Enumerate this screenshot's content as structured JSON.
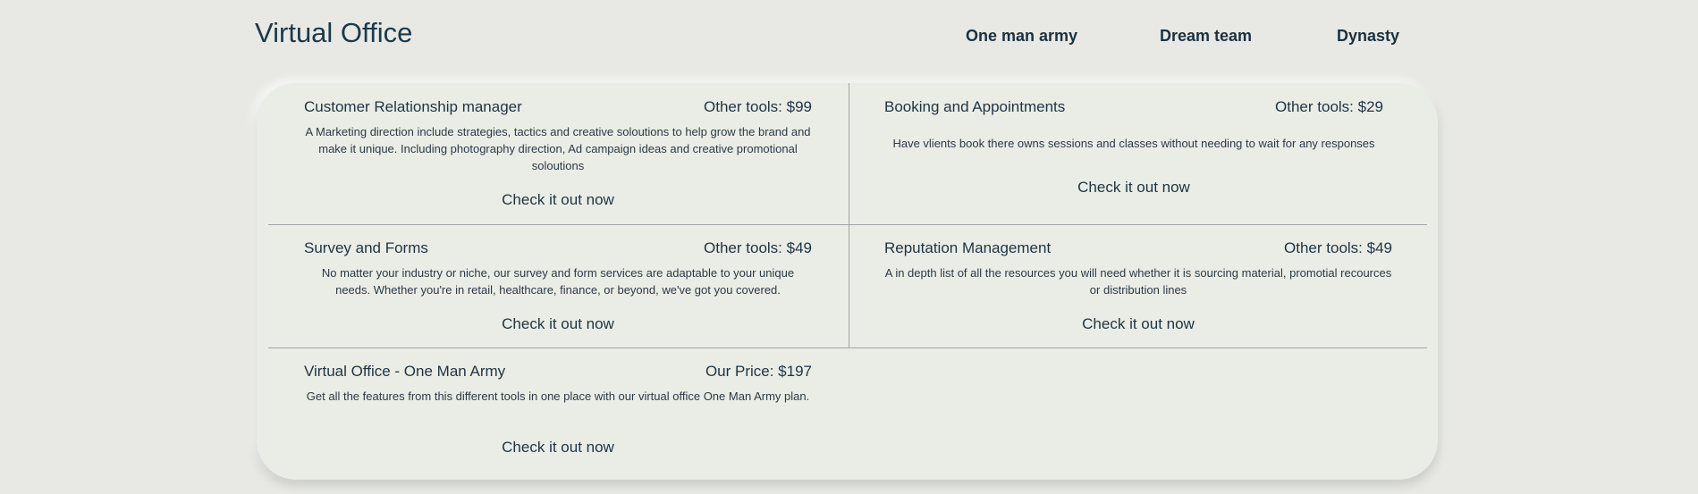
{
  "header": {
    "logo": "Virtual Office",
    "nav": [
      "One man army",
      "Dream team",
      "Dynasty"
    ]
  },
  "tools": [
    {
      "title": "Customer Relationship manager",
      "price": "Other tools: $99",
      "description": "A Marketing direction include strategies, tactics and creative soloutions to help grow the brand and make it unique. Including photography direction, Ad campaign ideas and creative promotional soloutions",
      "cta": "Check it out now"
    },
    {
      "title": "Booking and Appointments",
      "price": "Other tools: $29",
      "description": "Have vlients book there owns sessions and classes without needing to wait for any responses",
      "cta": "Check it out now"
    },
    {
      "title": "Survey and Forms",
      "price": "Other tools: $49",
      "description": "No matter your industry or niche, our survey and form services are adaptable to your unique needs. Whether you're in retail, healthcare, finance, or beyond, we've got you covered.",
      "cta": "Check it out now"
    },
    {
      "title": "Reputation Management",
      "price": "Other tools: $49",
      "description": "A in depth list of all the resources you will need whether it is sourcing material, promotial recources or distribution lines",
      "cta": "Check it out now"
    },
    {
      "title": "Virtual Office - One Man Army",
      "price": "Our Price: $197",
      "description": "Get all the features from this different tools in one place with our virtual office One Man Army plan.",
      "cta": "Check it out now"
    }
  ]
}
